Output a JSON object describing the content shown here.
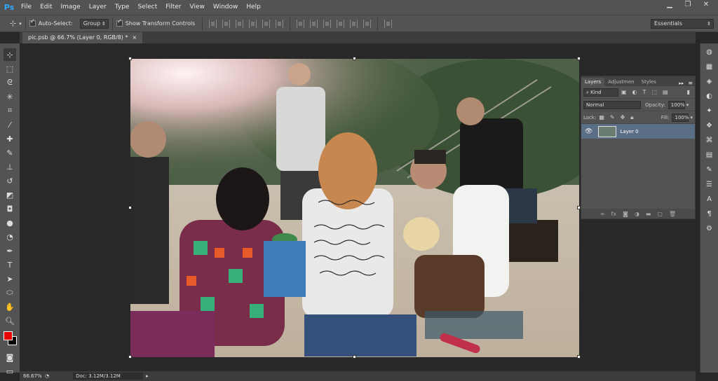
{
  "app": {
    "logo": "Ps"
  },
  "menu": [
    "File",
    "Edit",
    "Image",
    "Layer",
    "Type",
    "Select",
    "Filter",
    "View",
    "Window",
    "Help"
  ],
  "window_controls": {
    "minimize": "▁",
    "restore": "❐",
    "close": "✕"
  },
  "options": {
    "auto_select_label": "Auto-Select:",
    "auto_select_value": "Group",
    "show_transform_label": "Show Transform Controls",
    "workspace": "Essentials"
  },
  "document": {
    "tab_title": "pic.psb @ 66.7% (Layer 0, RGB/8) *",
    "tab_close": "×"
  },
  "status": {
    "zoom": "66.67%",
    "doc": "Doc: 3.12M/3.12M"
  },
  "layers_panel": {
    "tabs": [
      "Layers",
      "Adjustmen",
      "Styles"
    ],
    "filter_kind": "Kind",
    "blend_mode": "Normal",
    "opacity_label": "Opacity:",
    "opacity_value": "100%",
    "lock_label": "Lock:",
    "fill_label": "Fill:",
    "fill_value": "100%",
    "layers": [
      {
        "name": "Layer 0",
        "visible": true,
        "selected": true
      }
    ]
  },
  "colors": {
    "foreground": "#e60000",
    "background": "#000000",
    "accent": "#31a8ff",
    "selected_layer": "#5a6e86"
  }
}
